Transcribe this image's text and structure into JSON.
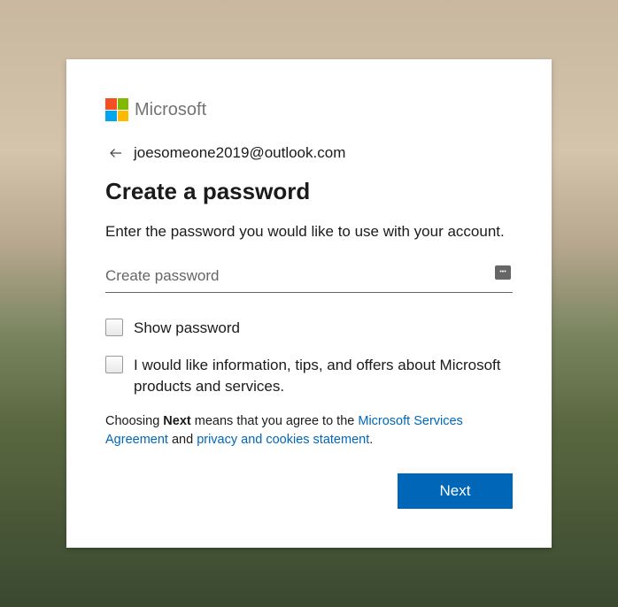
{
  "brand": "Microsoft",
  "identity": {
    "email": "joesomeone2019@outlook.com"
  },
  "title": "Create a password",
  "description": "Enter the password you would like to use with your account.",
  "password": {
    "placeholder": "Create password",
    "value": ""
  },
  "checkboxes": {
    "show_password_label": "Show password",
    "optin_label": "I would like information, tips, and offers about Microsoft products and services."
  },
  "legal": {
    "prefix": "Choosing ",
    "bold": "Next",
    "mid": " means that you agree to the ",
    "link1": "Microsoft Services Agreement",
    "and": " and ",
    "link2": "privacy and cookies statement",
    "suffix": "."
  },
  "buttons": {
    "next": "Next"
  }
}
